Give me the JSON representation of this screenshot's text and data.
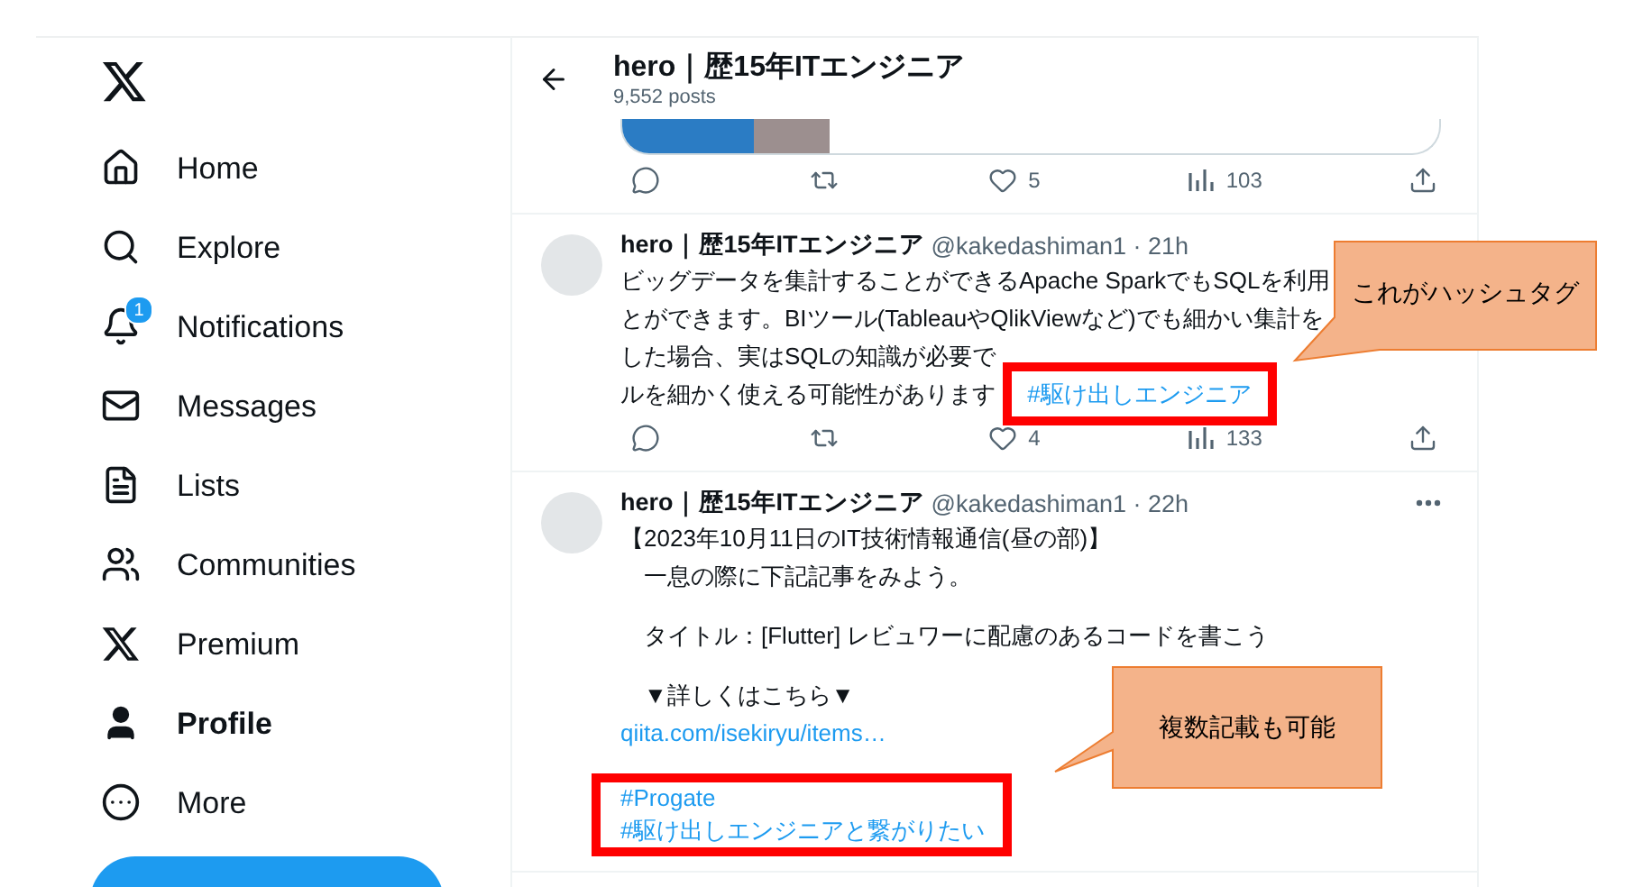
{
  "sidebar": {
    "nav": [
      {
        "kind": "home",
        "label": "Home",
        "selected": false
      },
      {
        "kind": "explore",
        "label": "Explore",
        "selected": false
      },
      {
        "kind": "notifications",
        "label": "Notifications",
        "selected": false,
        "badge": "1"
      },
      {
        "kind": "messages",
        "label": "Messages",
        "selected": false
      },
      {
        "kind": "lists",
        "label": "Lists",
        "selected": false
      },
      {
        "kind": "communities",
        "label": "Communities",
        "selected": false
      },
      {
        "kind": "premium",
        "label": "Premium",
        "selected": false
      },
      {
        "kind": "profile",
        "label": "Profile",
        "selected": true
      },
      {
        "kind": "more",
        "label": "More",
        "selected": false
      }
    ]
  },
  "header": {
    "title": "hero｜歴15年ITエンジニア",
    "subtitle": "9,552 posts"
  },
  "posts": [
    {
      "kind": "media_only",
      "actions": [
        {
          "kind": "reply"
        },
        {
          "kind": "repost"
        },
        {
          "kind": "like",
          "count": "5"
        },
        {
          "kind": "views",
          "count": "103"
        },
        {
          "kind": "share"
        }
      ]
    },
    {
      "kind": "post",
      "author": "hero｜歴15年ITエンジニア",
      "meta": "@kakedashiman1 · 21h",
      "paragraphs": [
        {
          "kind": "plain",
          "lines": [
            {
              "kind": "text",
              "text": "ビッグデータを集計することができるApache SparkでもSQLを利用"
            },
            {
              "kind": "text",
              "text": "とができます。BIツール(TableauやQlikViewなど)でも細かい集計を"
            },
            {
              "kind": "text",
              "text": "した場合、実はSQLの知識が必要で"
            },
            {
              "kind": "text",
              "text": "ルを細かく使える可能性があります",
              "tag": {
                "kind": "highlighted",
                "text": "#駆け出しエンジニア"
              }
            }
          ]
        }
      ],
      "callout": {
        "text": "これがハッシュタグ"
      },
      "actions": [
        {
          "kind": "reply"
        },
        {
          "kind": "repost"
        },
        {
          "kind": "like",
          "count": "4"
        },
        {
          "kind": "views",
          "count": "133"
        },
        {
          "kind": "share"
        }
      ]
    },
    {
      "kind": "post",
      "author": "hero｜歴15年ITエンジニア",
      "meta": "@kakedashiman1 · 22h",
      "more": true,
      "paragraphs": [
        {
          "kind": "plain",
          "lines": [
            {
              "kind": "text",
              "text": "【2023年10月11日のIT技術情報通信(昼の部)】"
            },
            {
              "kind": "text",
              "text": "　一息の際に下記記事をみよう。"
            }
          ]
        },
        {
          "kind": "plain",
          "lines": [
            {
              "kind": "text",
              "text": "　タイトル：[Flutter] レビュワーに配慮のあるコードを書こう"
            }
          ]
        },
        {
          "kind": "plain",
          "lines": [
            {
              "kind": "text",
              "text": "　▼詳しくはこちら▼"
            },
            {
              "kind": "link",
              "text": "qiita.com/isekiryu/items…"
            }
          ]
        },
        {
          "kind": "highlighted",
          "lines": [
            {
              "kind": "hashtag",
              "text": "#Progate"
            },
            {
              "kind": "hashtag",
              "text": "#駆け出しエンジニアと繋がりたい"
            }
          ]
        }
      ],
      "callout": {
        "text": "複数記載も可能"
      }
    }
  ]
}
